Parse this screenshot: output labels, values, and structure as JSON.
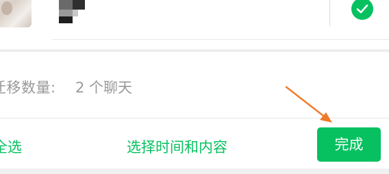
{
  "chat": {
    "avatar_icon": "contact-avatar",
    "name_icon": "pixelated-name",
    "selected_icon": "check-circle-icon"
  },
  "migration": {
    "count_label": "迁移数量:",
    "count_value": "2 个聊天"
  },
  "toolbar": {
    "select_all_label": "全选",
    "select_time_label": "选择时间和内容",
    "done_label": "完成"
  },
  "annotation": {
    "icon": "orange-arrow-icon"
  },
  "colors": {
    "accent": "#07c160",
    "muted_text": "#999999",
    "arrow": "#f07a2a"
  }
}
